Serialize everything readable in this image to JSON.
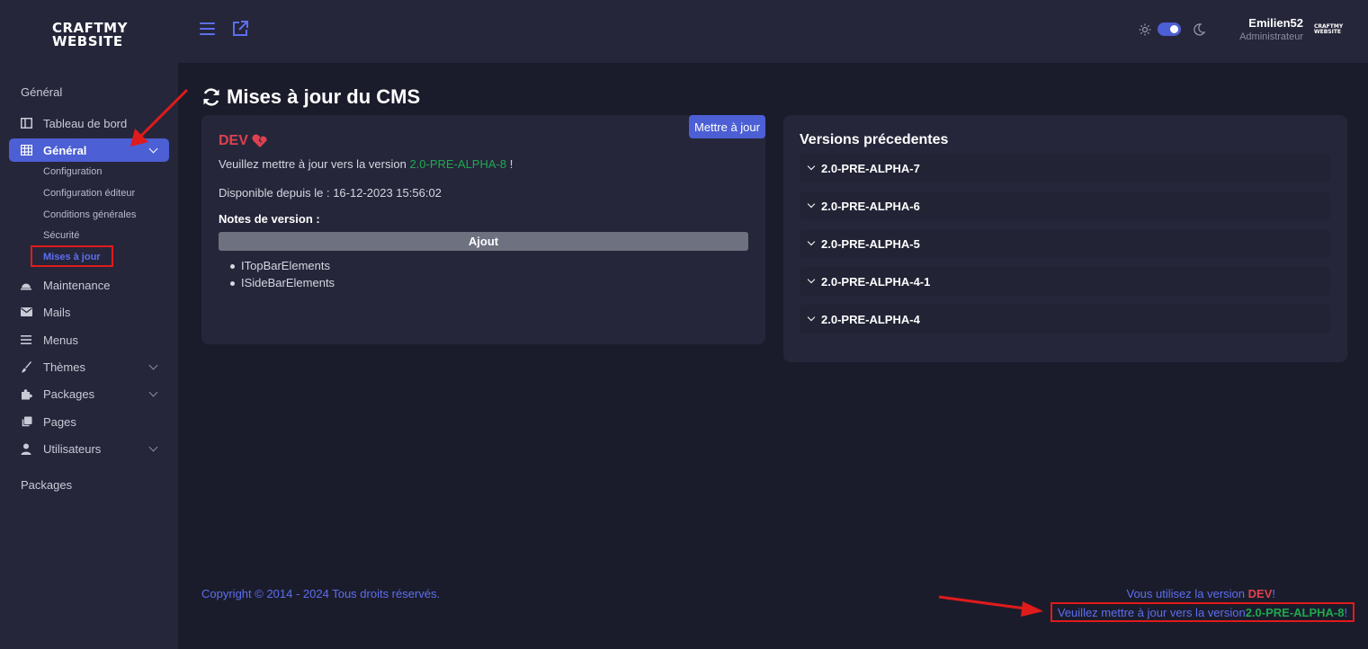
{
  "brand": {
    "logo_line1": "CRAFTMY",
    "logo_line2": "WEBSITE"
  },
  "sidebar": {
    "section_general": "Général",
    "section_packages": "Packages",
    "items": [
      {
        "label": "Tableau de bord",
        "icon": "dashboard-icon"
      },
      {
        "label": "Général",
        "icon": "grid-icon",
        "active": true
      },
      {
        "label": "Maintenance",
        "icon": "helmet-icon"
      },
      {
        "label": "Mails",
        "icon": "envelope-icon"
      },
      {
        "label": "Menus",
        "icon": "list-icon"
      },
      {
        "label": "Thèmes",
        "icon": "brush-icon"
      },
      {
        "label": "Packages",
        "icon": "puzzle-icon"
      },
      {
        "label": "Pages",
        "icon": "pages-icon"
      },
      {
        "label": "Utilisateurs",
        "icon": "user-icon"
      }
    ],
    "sub_items": [
      {
        "label": "Configuration"
      },
      {
        "label": "Configuration éditeur"
      },
      {
        "label": "Conditions générales"
      },
      {
        "label": "Sécurité"
      },
      {
        "label": "Mises à jour",
        "current": true
      }
    ]
  },
  "topbar": {
    "user_name": "Emilien52",
    "user_role": "Administrateur",
    "avatar_line1": "CRAFTMY",
    "avatar_line2": "WEBSITE"
  },
  "main": {
    "title": "Mises à jour du CMS",
    "update_button": "Mettre à jour",
    "current_version": "DEV",
    "update_prompt_prefix": "Veuillez mettre à jour vers la version",
    "update_target": "2.0-PRE-ALPHA-8",
    "update_prompt_suffix": "!",
    "available_since": "Disponible depuis le : 16-12-2023 15:56:02",
    "notes_title": "Notes de version :",
    "notes_category": "Ajout",
    "notes": [
      "ITopBarElements",
      "ISideBarElements"
    ],
    "previous_title": "Versions précedentes",
    "previous_versions": [
      "2.0-PRE-ALPHA-7",
      "2.0-PRE-ALPHA-6",
      "2.0-PRE-ALPHA-5",
      "2.0-PRE-ALPHA-4-1",
      "2.0-PRE-ALPHA-4"
    ]
  },
  "footer": {
    "copyright": "Copyright © 2014 - 2024 Tous droits réservés.",
    "using_prefix": "Vous utilisez la version",
    "using_version": "DEV",
    "using_suffix": "!",
    "update_prefix": "Veuillez mettre à jour vers la version",
    "update_version": "2.0-PRE-ALPHA-8",
    "update_suffix": "!"
  },
  "colors": {
    "accent": "#4c5fd4",
    "danger": "#e0414f",
    "success": "#1fa84f",
    "annotation": "#e01b1b"
  }
}
